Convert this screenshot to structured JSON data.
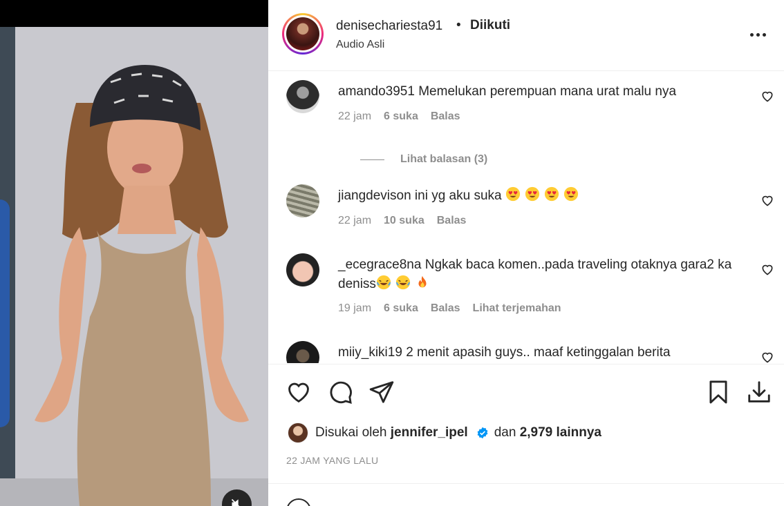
{
  "post": {
    "username": "denisechariesta91",
    "separator": "•",
    "follow_label": "Diikuti",
    "audio_label": "Audio Asli"
  },
  "comments": [
    {
      "username": "amando3951",
      "text": "Memelukan perempuan mana urat malu nya",
      "time": "22 jam",
      "likes": "6 suka",
      "reply": "Balas",
      "view_replies": "Lihat balasan (3)"
    },
    {
      "username": "jiangdevison",
      "text": "ini yg aku suka",
      "emojis": [
        "heart-eyes-emoji",
        "heart-eyes-emoji",
        "heart-eyes-emoji",
        "heart-eyes-emoji"
      ],
      "time": "22 jam",
      "likes": "10 suka",
      "reply": "Balas"
    },
    {
      "username": "_ecegrace8na",
      "text": "Ngkak baca komen..pada traveling otaknya gara2 ka deniss",
      "emojis": [
        "laughing-tears-emoji",
        "laughing-tears-emoji",
        "fire-emoji"
      ],
      "time": "19 jam",
      "likes": "6 suka",
      "reply": "Balas",
      "translate": "Lihat terjemahan"
    },
    {
      "username": "miiy_kiki19",
      "text": "2 menit apasih guys.. maaf ketinggalan berita"
    }
  ],
  "likes_summary": {
    "prefix": "Disukai oleh",
    "liked_by": "jennifer_ipel",
    "and": "dan",
    "count": "2,979 lainnya"
  },
  "time_ago": "22 JAM YANG LALU",
  "colors": {
    "text": "#262626",
    "muted": "#8e8e8e",
    "verified": "#0095f6",
    "post_disabled": "#b2dffc"
  },
  "icons": [
    "heart-icon",
    "comment-icon",
    "share-icon",
    "bookmark-icon",
    "download-icon",
    "mute-icon",
    "more-icon",
    "verified-icon",
    "emoji-icon"
  ]
}
